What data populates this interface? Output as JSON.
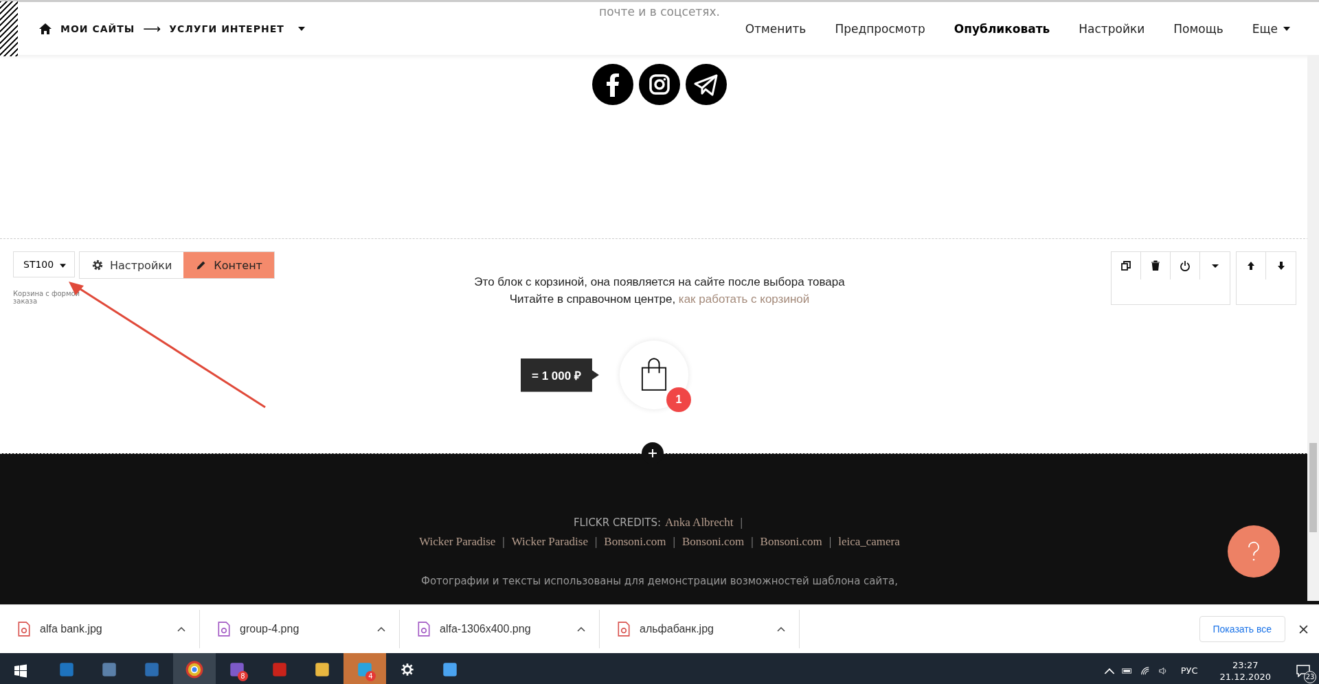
{
  "header": {
    "breadcrumb": [
      "МОИ САЙТЫ",
      "УСЛУГИ ИНТЕРНЕТ"
    ],
    "separator": "⟶",
    "behind_text": "почте и в соцсетях.",
    "menu": [
      {
        "label": "Отменить",
        "kind": "plain"
      },
      {
        "label": "Предпросмотр",
        "kind": "plain"
      },
      {
        "label": "Опубликовать",
        "kind": "primary"
      },
      {
        "label": "Настройки",
        "kind": "plain"
      },
      {
        "label": "Помощь",
        "kind": "plain"
      },
      {
        "label": "Еще",
        "kind": "dropdown"
      }
    ]
  },
  "social": [
    {
      "kind": "facebook"
    },
    {
      "kind": "instagram"
    },
    {
      "kind": "telegram"
    }
  ],
  "block": {
    "code": "ST100",
    "caption": "Корзина с формой заказа",
    "tabs": [
      {
        "label": "Настройки",
        "kind": "settings",
        "selected": false
      },
      {
        "label": "Контент",
        "kind": "edit",
        "selected": true
      }
    ],
    "info_line": "Это блок с корзиной, она появляется на сайте после выбора товара",
    "help_prefix": "Читайте в справочном центре,",
    "help_link": "как работать с корзиной",
    "cart_total": "= 1 000 ₽",
    "cart_count": "1"
  },
  "footer": {
    "credits_label": "FLICKR CREDITS:",
    "separator": "|",
    "credits": [
      "Anka Albrecht",
      "Wicker Paradise",
      "Wicker Paradise",
      "Bonsoni.com",
      "Bonsoni.com",
      "Bonsoni.com",
      "leica_camera"
    ],
    "notice": "Фотографии и тексты использованы для демонстрации возможностей шаблона сайта,"
  },
  "downloads": {
    "items": [
      {
        "name": "alfa bank.jpg",
        "color": "#d9534f"
      },
      {
        "name": "group-4.png",
        "color": "#a259c4"
      },
      {
        "name": "alfa-1306x400.png",
        "color": "#a259c4"
      },
      {
        "name": "альфабанк.jpg",
        "color": "#d9534f"
      }
    ],
    "show_all": "Показать все"
  },
  "taskbar": {
    "apps": [
      {
        "kind": "outlook",
        "active": false
      },
      {
        "kind": "calculator",
        "active": false
      },
      {
        "kind": "disk",
        "active": false
      },
      {
        "kind": "chrome",
        "active": true
      },
      {
        "kind": "viber",
        "active": false,
        "badge": "8"
      },
      {
        "kind": "pdf",
        "active": false
      },
      {
        "kind": "folder",
        "active": false
      },
      {
        "kind": "telegram",
        "active": true,
        "badge": "4"
      },
      {
        "kind": "gear",
        "active": false
      },
      {
        "kind": "stream",
        "active": false
      }
    ],
    "lang": "РУС",
    "time": "23:27",
    "date": "21.12.2020",
    "notifications": "23"
  }
}
